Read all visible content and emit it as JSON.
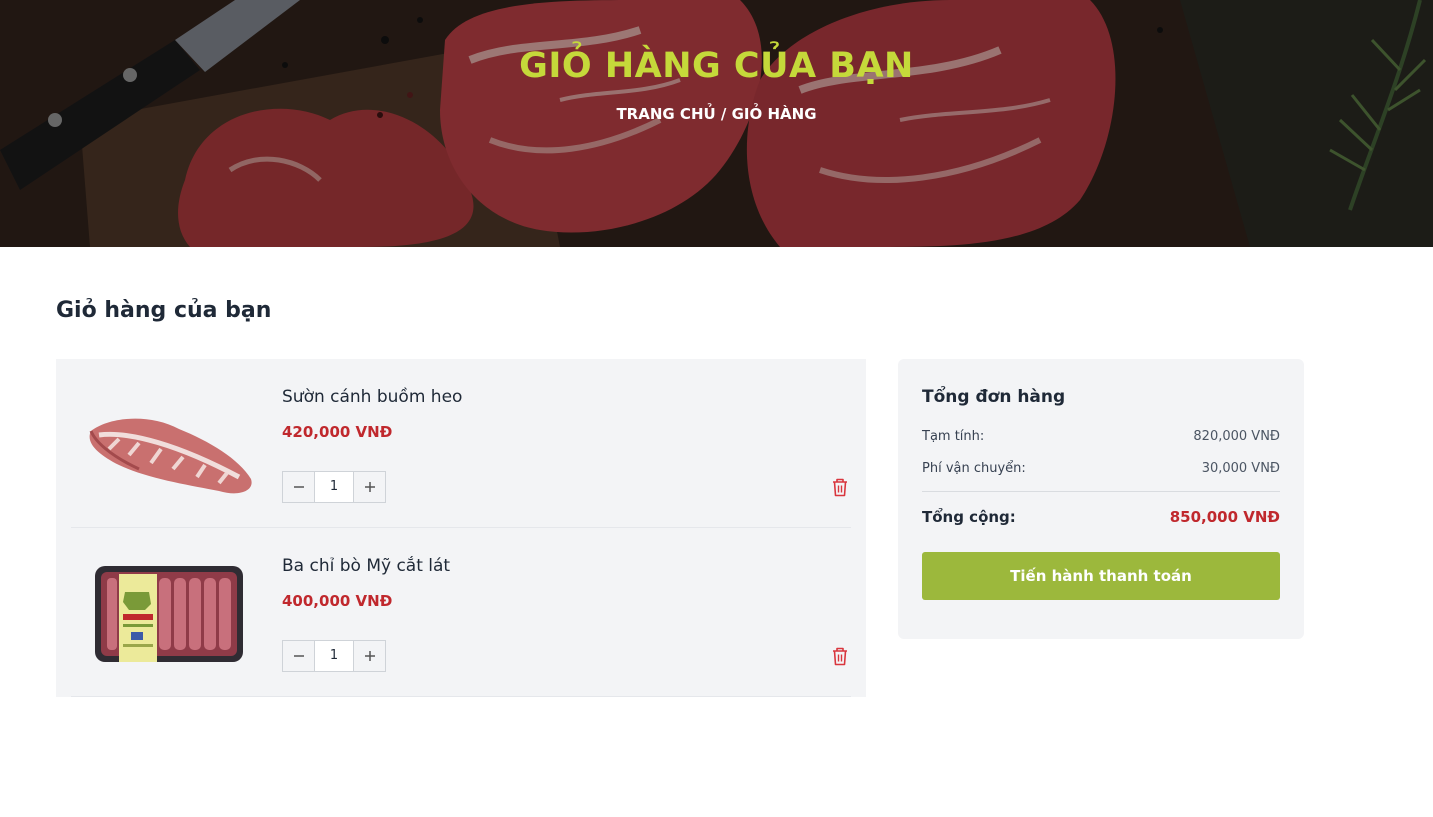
{
  "hero": {
    "title": "GIỎ HÀNG CỦA BẠN",
    "breadcrumb": {
      "home": "TRANG CHỦ",
      "separator": " / ",
      "current": "GIỎ HÀNG"
    }
  },
  "page_title": "Giỏ hàng của bạn",
  "cart": {
    "items": [
      {
        "name": "Sườn cánh buồm heo",
        "price": "420,000 VNĐ",
        "quantity": "1",
        "image_icon": "pork-ribs-image"
      },
      {
        "name": "Ba chỉ bò Mỹ cắt lát",
        "price": "400,000 VNĐ",
        "quantity": "1",
        "image_icon": "beef-slices-pack-image"
      }
    ]
  },
  "summary": {
    "title": "Tổng đơn hàng",
    "subtotal_label": "Tạm tính:",
    "subtotal_value": "820,000 VNĐ",
    "shipping_label": "Phí vận chuyển:",
    "shipping_value": "30,000 VNĐ",
    "total_label": "Tổng cộng:",
    "total_value": "850,000 VNĐ",
    "checkout_label": "Tiến hành thanh toán"
  },
  "colors": {
    "accent_title": "#c5d93a",
    "price_red": "#c0282d",
    "checkout_green": "#9cb83c",
    "panel_gray": "#f3f4f6"
  }
}
